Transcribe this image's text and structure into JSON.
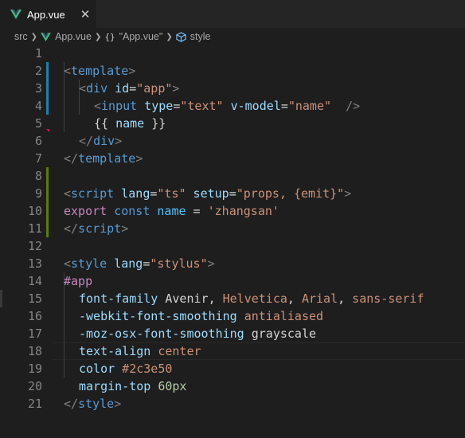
{
  "tab": {
    "label": "App.vue",
    "icon": "vue-icon",
    "close": "✕"
  },
  "breadcrumb": {
    "folder": "src",
    "file": "App.vue",
    "braces": "{}",
    "component": "\"App.vue\"",
    "symbol": "style"
  },
  "code_lines": [
    {
      "n": "1"
    },
    {
      "n": "2"
    },
    {
      "n": "3"
    },
    {
      "n": "4"
    },
    {
      "n": "5"
    },
    {
      "n": "6"
    },
    {
      "n": "7"
    },
    {
      "n": "8"
    },
    {
      "n": "9"
    },
    {
      "n": "10"
    },
    {
      "n": "11"
    },
    {
      "n": "12"
    },
    {
      "n": "13"
    },
    {
      "n": "14"
    },
    {
      "n": "15"
    },
    {
      "n": "16"
    },
    {
      "n": "17"
    },
    {
      "n": "18"
    },
    {
      "n": "19"
    },
    {
      "n": "20"
    },
    {
      "n": "21"
    }
  ],
  "code": {
    "l1": {
      "lt": "<",
      "tag": "template",
      "gt": ">"
    },
    "l2": {
      "lt": "<",
      "tag": "div",
      "attr": " id",
      "eq": "=",
      "val": "\"app\"",
      "gt": ">"
    },
    "l3": {
      "lt": "<",
      "tag": "input",
      "a1": " type",
      "eq1": "=",
      "v1": "\"text\"",
      "a2": " v-model",
      "eq2": "=",
      "v2": "\"name\"",
      "end": "  />"
    },
    "l4": {
      "text": "{{ ",
      "var": "name",
      "close": " }}"
    },
    "l5": {
      "lt": "</",
      "tag": "div",
      "gt": ">"
    },
    "l6": {
      "lt": "</",
      "tag": "template",
      "gt": ">"
    },
    "l8": {
      "lt": "<",
      "tag": "script",
      "a1": " lang",
      "eq1": "=",
      "v1": "\"ts\"",
      "a2": " setup",
      "eq2": "=",
      "v2": "\"props, {emit}\"",
      "gt": ">"
    },
    "l9": {
      "kw": "export",
      "decl": " const",
      "var": " name",
      "eq": " = ",
      "str": "'zhangsan'"
    },
    "l10": {
      "lt": "</",
      "tag": "script",
      "gt": ">"
    },
    "l12": {
      "lt": "<",
      "tag": "style",
      "a1": " lang",
      "eq1": "=",
      "v1": "\"stylus\"",
      "gt": ">"
    },
    "l13": {
      "sel": "#app"
    },
    "l14": {
      "prop": "font-family",
      "v1": " Avenir",
      "c1": ",",
      "v2": " Helvetica",
      "c2": ",",
      "v3": " Arial",
      "c3": ",",
      "v4": " sans-serif"
    },
    "l15": {
      "prop": "-webkit-font-smoothing",
      "val": " antialiased"
    },
    "l16": {
      "prop": "-moz-osx-font-smoothing",
      "val": " grayscale"
    },
    "l17": {
      "prop": "text-align",
      "val": " center"
    },
    "l18": {
      "prop": "color",
      "val": " #2c3e50"
    },
    "l19": {
      "prop": "margin-top",
      "val": " 60px"
    },
    "l20": {
      "lt": "</",
      "tag": "style",
      "gt": ">"
    }
  },
  "colors": {
    "background": "#1e1e1e",
    "tabbar": "#252526",
    "vue_green": "#41b883",
    "vue_dark": "#35495e",
    "gutter_modified": "#1b81a8",
    "gutter_added": "#587c0c",
    "gutter_deleted": "#c2185b"
  }
}
